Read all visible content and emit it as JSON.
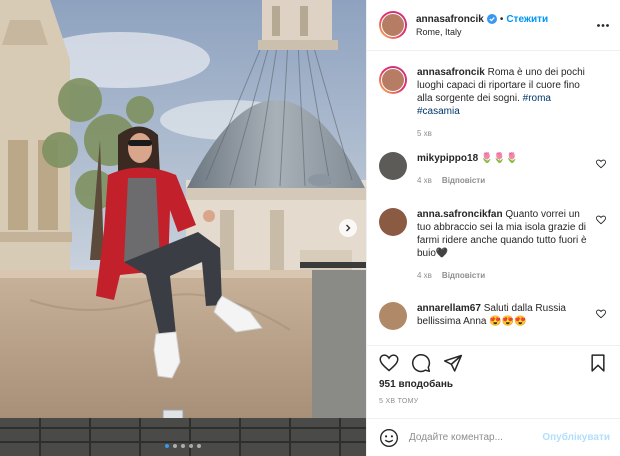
{
  "post": {
    "author": {
      "username": "annasafroncik",
      "follow_label": "Стежити",
      "location": "Rome, Italy",
      "verified": true
    },
    "caption": {
      "username": "annasafroncik",
      "text": "Roma è uno dei pochi luoghi capaci di riportare il cuore fino alla sorgente dei sogni.",
      "hashtags": [
        "#roma",
        "#casamia"
      ],
      "time": "5 хв"
    },
    "comments": [
      {
        "username": "mikypippo18",
        "text": "🌷🌷🌷",
        "time": "4 хв",
        "reply_label": "Відповісти"
      },
      {
        "username": "anna.safroncikfan",
        "text": "Quanto vorrei un tuo abbraccio sei la mia isola grazie di farmi ridere anche quando tutto fuori è buio🖤",
        "time": "4 хв",
        "reply_label": "Відповісти"
      },
      {
        "username": "annarellam67",
        "text": "Saluti dalla Russia bellissima Anna 😍😍😍",
        "time": "",
        "reply_label": ""
      }
    ],
    "likes": "951 вподобань",
    "time_ago": "5 ХВ ТОМУ",
    "add_comment": {
      "placeholder": "Додайте коментар...",
      "publish_label": "Опублікувати"
    },
    "carousel": {
      "dot_count": 5,
      "active_index": 0
    }
  },
  "colors": {
    "accent": "#0095f6",
    "muted": "#8e8e8e",
    "publish_disabled": "#b2dffc"
  },
  "icons": {
    "header_more": "more-dots-icon",
    "like": "heart-icon",
    "comment": "comment-bubble-icon",
    "share": "paper-plane-icon",
    "save": "bookmark-icon",
    "emoji": "smiley-icon",
    "next": "chevron-right-icon",
    "verified": "verified-badge-icon"
  }
}
